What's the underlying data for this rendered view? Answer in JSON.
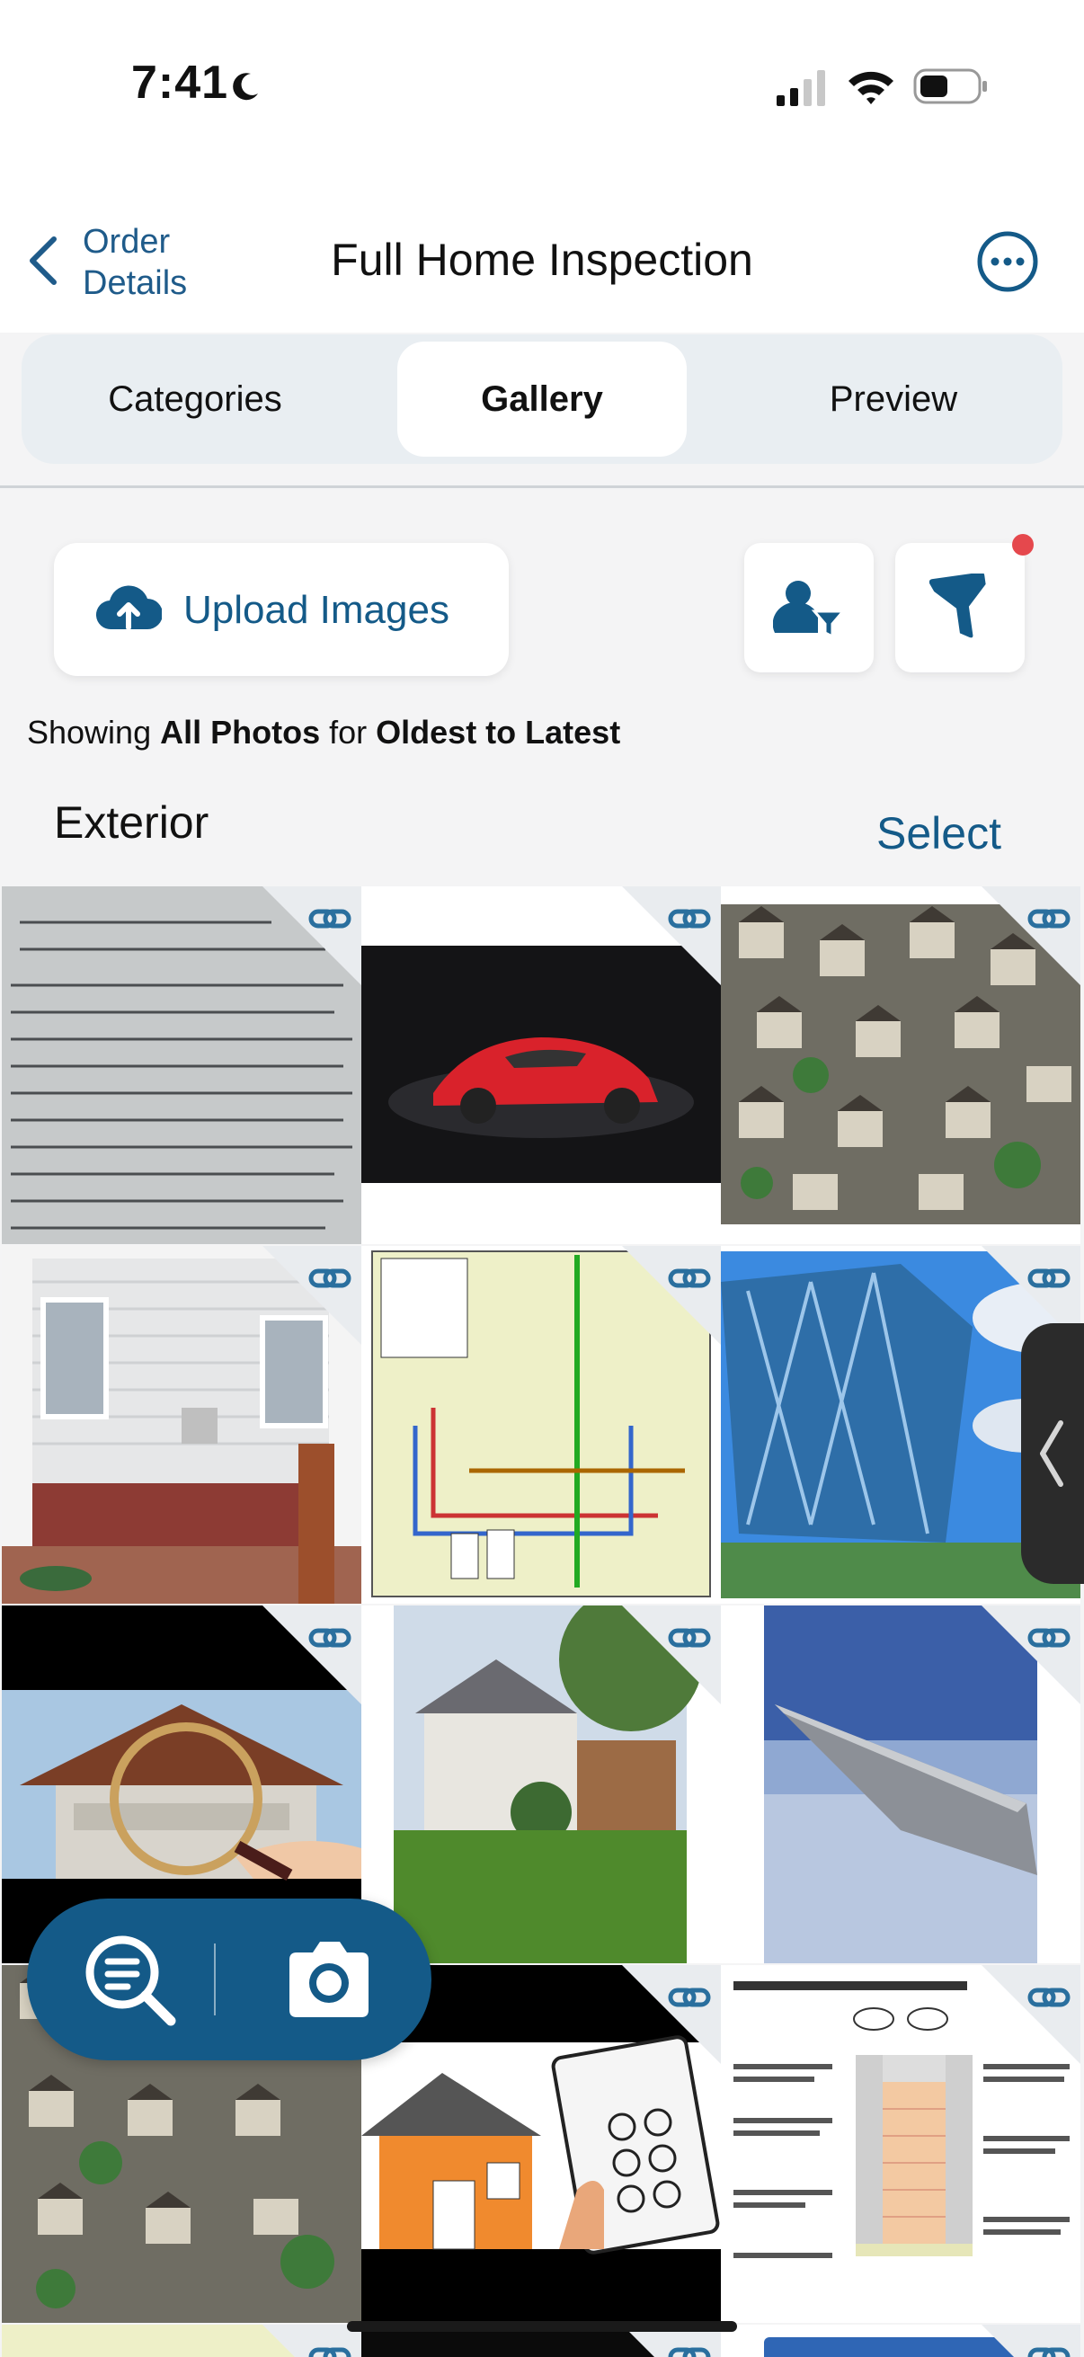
{
  "status_bar": {
    "time": "7:41",
    "icons": [
      "moon-icon",
      "signal-icon",
      "wifi-icon",
      "battery-icon"
    ]
  },
  "header": {
    "back_label_line1": "Order",
    "back_label_line2": "Details",
    "title": "Full Home Inspection",
    "more_icon": "ellipsis-circle-icon"
  },
  "tabs": [
    {
      "label": "Categories",
      "active": false
    },
    {
      "label": "Gallery",
      "active": true
    },
    {
      "label": "Preview",
      "active": false
    }
  ],
  "toolbar": {
    "upload_label": "Upload Images",
    "upload_icon": "cloud-upload-icon",
    "user_filter_icon": "user-filter-icon",
    "funnel_icon": "funnel-icon",
    "filter_badge_color": "#e5484d"
  },
  "filter_summary": {
    "prefix": "Showing",
    "filter": "All Photos",
    "middle": "for",
    "sort": "Oldest to Latest"
  },
  "section": {
    "title": "Exterior",
    "select_label": "Select"
  },
  "gallery": [
    {
      "name": "ac-unit-label-photo"
    },
    {
      "name": "red-sports-car-photo"
    },
    {
      "name": "aerial-houses-photo"
    },
    {
      "name": "house-siding-window-photo"
    },
    {
      "name": "plumbing-diagram-image"
    },
    {
      "name": "glass-office-building-photo"
    },
    {
      "name": "magnifying-glass-house-photo"
    },
    {
      "name": "suburban-house-yard-photo"
    },
    {
      "name": "airplane-wing-photo"
    },
    {
      "name": "aerial-houses-photo-2"
    },
    {
      "name": "inspection-clipboard-illustration"
    },
    {
      "name": "tile-debonding-diagram"
    }
  ],
  "fab": {
    "search_report_icon": "document-search-icon",
    "camera_icon": "camera-icon"
  },
  "colors": {
    "accent": "#145a88",
    "link_badge": "#2a6f9e",
    "background": "#f4f4f5"
  }
}
